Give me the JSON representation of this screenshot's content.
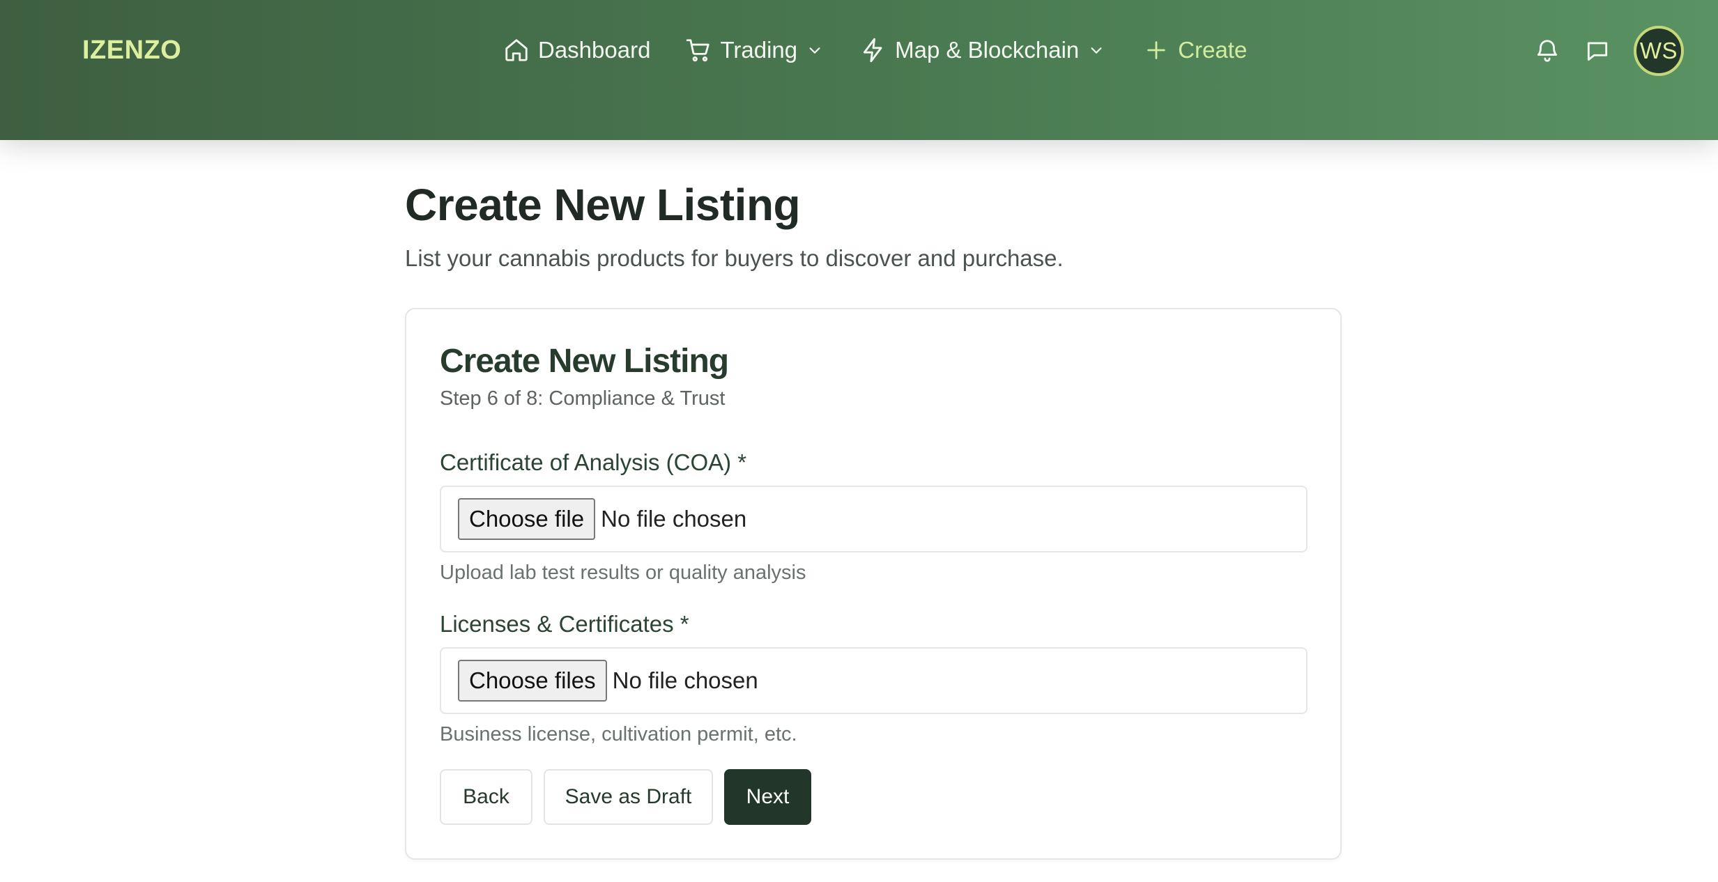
{
  "header": {
    "brand": "IZENZO",
    "nav": {
      "dashboard": "Dashboard",
      "trading": "Trading",
      "map": "Map & Blockchain",
      "create": "Create"
    },
    "avatar_initials": "WS",
    "icons": [
      "home-icon",
      "cart-icon",
      "chevron-down-icon",
      "lightning-icon",
      "plus-icon",
      "bell-icon",
      "chat-icon"
    ]
  },
  "page": {
    "title": "Create New Listing",
    "subtitle": "List your cannabis products for buyers to discover and purchase."
  },
  "card": {
    "title": "Create New Listing",
    "step": "Step 6 of 8: Compliance & Trust",
    "coa": {
      "label": "Certificate of Analysis (COA) *",
      "button": "Choose file",
      "status": "No file chosen",
      "help": "Upload lab test results or quality analysis"
    },
    "licenses": {
      "label": "Licenses & Certificates *",
      "button": "Choose files",
      "status": "No file chosen",
      "help": "Business license, cultivation permit, etc."
    },
    "actions": {
      "back": "Back",
      "draft": "Save as Draft",
      "next": "Next"
    }
  },
  "colors": {
    "header_gradient_start": "#3e5f41",
    "header_gradient_end": "#5a9263",
    "brand_accent": "#dcef9f",
    "primary_button": "#22362a"
  }
}
